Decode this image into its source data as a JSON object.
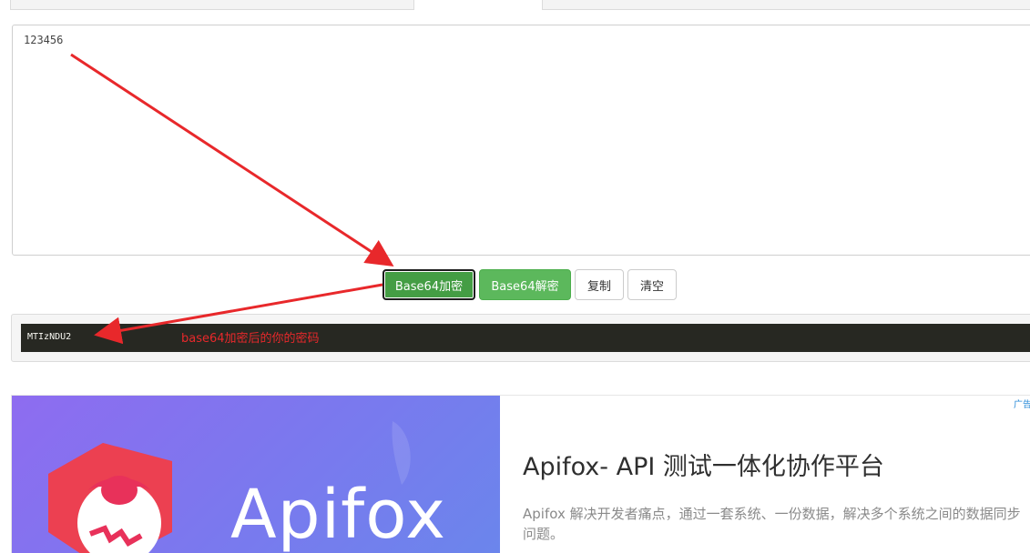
{
  "input": {
    "value": "123456"
  },
  "buttons": {
    "encode_label": "Base64加密",
    "decode_label": "Base64解密",
    "copy_label": "复制",
    "clear_label": "清空"
  },
  "output": {
    "value": "MTIzNDU2"
  },
  "annotation": {
    "text": "base64加密后的你的密码",
    "color": "#e8282b"
  },
  "ad": {
    "tag": "广告",
    "logo_text": "Apifox",
    "title": "Apifox- API 测试一体化协作平台",
    "description": "Apifox 解决开发者痛点，通过一套系统、一份数据，解决多个系统之间的数据同步问题。"
  },
  "colors": {
    "accent_green": "#5cb85c",
    "accent_green_active": "#449d44",
    "output_bg": "#272822",
    "ad_gradient_start": "#8e6cf0",
    "ad_gradient_end": "#6a86ec"
  }
}
